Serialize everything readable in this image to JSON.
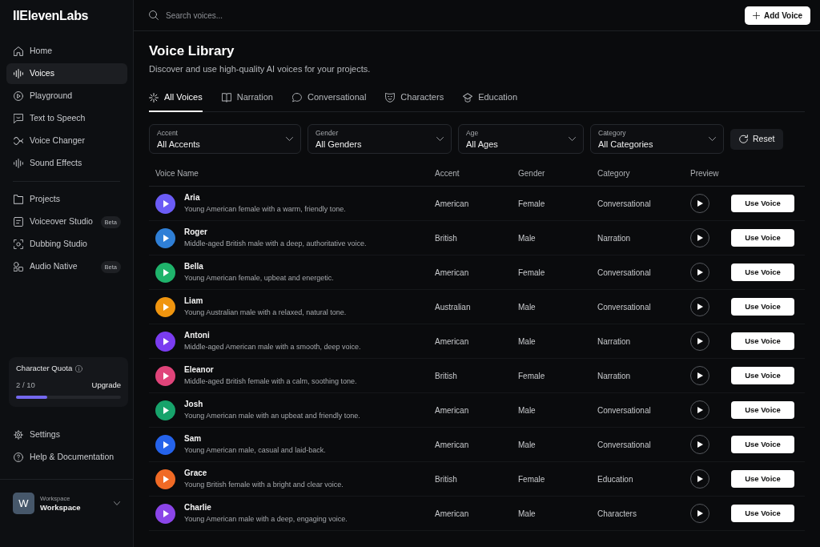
{
  "sidebar": {
    "logo": "IIElevenLabs",
    "nav_groups": [
      [
        {
          "label": "Home",
          "selected": false
        },
        {
          "label": "Voices",
          "selected": true
        },
        {
          "label": "Playground",
          "selected": false
        },
        {
          "label": "Text to Speech",
          "selected": false
        },
        {
          "label": "Voice Changer",
          "selected": false
        },
        {
          "label": "Sound Effects",
          "selected": false
        }
      ],
      [
        {
          "label": "Projects",
          "selected": false
        },
        {
          "label": "Voiceover Studio",
          "selected": false,
          "badge": "Beta"
        },
        {
          "label": "Dubbing Studio",
          "selected": false
        },
        {
          "label": "Audio Native",
          "selected": false,
          "badge": "Beta"
        }
      ]
    ],
    "quota": {
      "title": "Character Quota",
      "usage": "2 / 10",
      "link": "Upgrade",
      "level": 0.3
    },
    "footer_items": [
      {
        "label": "Settings",
        "selected": false
      },
      {
        "label": "Help & Documentation",
        "selected": false
      }
    ],
    "workspace": {
      "initial": "W",
      "caption": "Workspace",
      "name": "Workspace"
    }
  },
  "header": {
    "search": {
      "placeholder": "Search voices..."
    },
    "add_button": "Add Voice"
  },
  "page": {
    "title": "Voice Library",
    "subtitle": "Discover and use high-quality AI voices for your projects."
  },
  "tabs": [
    {
      "label": "All Voices",
      "selected": true
    },
    {
      "label": "Narration",
      "selected": false
    },
    {
      "label": "Conversational",
      "selected": false
    },
    {
      "label": "Characters",
      "selected": false
    },
    {
      "label": "Education",
      "selected": false
    }
  ],
  "filters": [
    {
      "label": "Accent",
      "value": "All Accents"
    },
    {
      "label": "Gender",
      "value": "All Genders"
    },
    {
      "label": "Age",
      "value": "All Ages"
    },
    {
      "label": "Category",
      "value": "All Categories"
    }
  ],
  "reset_button": "Reset",
  "table": {
    "columns": [
      "Voice Name",
      "Accent",
      "Gender",
      "Category",
      "Preview"
    ],
    "rows": [
      {
        "name": "Aria",
        "description": "Young American female with a warm, friendly tone.",
        "accent": "American",
        "gender": "Female",
        "category": "Conversational",
        "color": "#6b5cf6",
        "action": "Use Voice"
      },
      {
        "name": "Roger",
        "description": "Middle-aged British male with a deep, authoritative voice.",
        "accent": "British",
        "gender": "Male",
        "category": "Narration",
        "color": "#2f7fd6",
        "action": "Use Voice"
      },
      {
        "name": "Bella",
        "description": "Young American female, upbeat and energetic.",
        "accent": "American",
        "gender": "Female",
        "category": "Conversational",
        "color": "#1fb36b",
        "action": "Use Voice"
      },
      {
        "name": "Liam",
        "description": "Young Australian male with a relaxed, natural tone.",
        "accent": "Australian",
        "gender": "Male",
        "category": "Conversational",
        "color": "#f0950f",
        "action": "Use Voice"
      },
      {
        "name": "Antoni",
        "description": "Middle-aged American male with a smooth, deep voice.",
        "accent": "American",
        "gender": "Male",
        "category": "Narration",
        "color": "#7a3cf0",
        "action": "Use Voice"
      },
      {
        "name": "Eleanor",
        "description": "Middle-aged British female with a calm, soothing tone.",
        "accent": "British",
        "gender": "Female",
        "category": "Narration",
        "color": "#e0447a",
        "action": "Use Voice"
      },
      {
        "name": "Josh",
        "description": "Young American male with an upbeat and friendly tone.",
        "accent": "American",
        "gender": "Male",
        "category": "Conversational",
        "color": "#17a36b",
        "action": "Use Voice"
      },
      {
        "name": "Sam",
        "description": "Young American male, casual and laid-back.",
        "accent": "American",
        "gender": "Male",
        "category": "Conversational",
        "color": "#2563eb",
        "action": "Use Voice"
      },
      {
        "name": "Grace",
        "description": "Young British female with a bright and clear voice.",
        "accent": "British",
        "gender": "Female",
        "category": "Education",
        "color": "#f06a25",
        "action": "Use Voice"
      },
      {
        "name": "Charlie",
        "description": "Young American male with a deep, engaging voice.",
        "accent": "American",
        "gender": "Male",
        "category": "Characters",
        "color": "#8b45e8",
        "action": "Use Voice"
      }
    ]
  }
}
